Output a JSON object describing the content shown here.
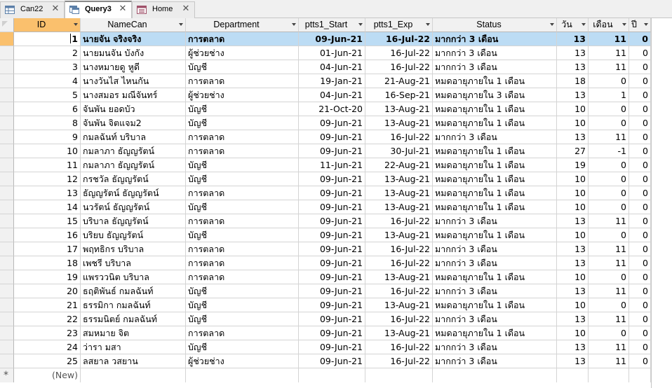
{
  "tabs": [
    {
      "label": "Can22",
      "active": false
    },
    {
      "label": "Query3",
      "active": true
    },
    {
      "label": "Home",
      "active": false
    }
  ],
  "columns": [
    "ID",
    "NameCan",
    "Department",
    "ptts1_Start",
    "ptts1_Exp",
    "Status",
    "วัน",
    "เดือน",
    "ปี"
  ],
  "rows": [
    [
      "1",
      "นายจัน จริงจริง",
      "การตลาด",
      "09-Jun-21",
      "16-Jul-22",
      "มากกว่า 3 เดือน",
      "13",
      "11",
      "0"
    ],
    [
      "2",
      "นายมนจัน บังกัง",
      "ผู้ช่วยช่าง",
      "01-Jun-21",
      "16-Jul-22",
      "มากกว่า 3 เดือน",
      "13",
      "11",
      "0"
    ],
    [
      "3",
      "นางหมายดู หูดี",
      "บัญชี",
      "04-Jun-21",
      "16-Jul-22",
      "มากกว่า 3 เดือน",
      "13",
      "11",
      "0"
    ],
    [
      "4",
      "นางวันไส ไหนกัน",
      "การตลาด",
      "19-Jan-21",
      "21-Aug-21",
      "หมดอายุภายใน 1 เดือน",
      "18",
      "0",
      "0"
    ],
    [
      "5",
      "นางสมอร มณีจันทร์",
      "ผู้ช่วยช่าง",
      "04-Jun-21",
      "16-Sep-21",
      "หมดอายุภายใน 3 เดือน",
      "13",
      "1",
      "0"
    ],
    [
      "6",
      "จันพัน ยอดบัว",
      "บัญชี",
      "21-Oct-20",
      "13-Aug-21",
      "หมดอายุภายใน 1 เดือน",
      "10",
      "0",
      "0"
    ],
    [
      "8",
      "จันพัน จิตแจม2",
      "บัญชี",
      "09-Jun-21",
      "13-Aug-21",
      "หมดอายุภายใน 1 เดือน",
      "10",
      "0",
      "0"
    ],
    [
      "9",
      "กมลฉันท์ บริบาล",
      "การตลาด",
      "09-Jun-21",
      "16-Jul-22",
      "มากกว่า 3 เดือน",
      "13",
      "11",
      "0"
    ],
    [
      "10",
      "กมลาภา ธัญญรัตน์",
      "การตลาด",
      "09-Jun-21",
      "30-Jul-21",
      "หมดอายุภายใน 1 เดือน",
      "27",
      "-1",
      "0"
    ],
    [
      "11",
      "กมลาภา ธัญญรัตน์",
      "บัญชี",
      "11-Jun-21",
      "22-Aug-21",
      "หมดอายุภายใน 1 เดือน",
      "19",
      "0",
      "0"
    ],
    [
      "12",
      "กรชวัล ธัญญรัตน์",
      "บัญชี",
      "09-Jun-21",
      "13-Aug-21",
      "หมดอายุภายใน 1 เดือน",
      "10",
      "0",
      "0"
    ],
    [
      "13",
      "ธัญญรัตน์ ธัญญรัตน์",
      "การตลาด",
      "09-Jun-21",
      "13-Aug-21",
      "หมดอายุภายใน 1 เดือน",
      "10",
      "0",
      "0"
    ],
    [
      "14",
      "นวรัตน์ ธัญญรัตน์",
      "บัญชี",
      "09-Jun-21",
      "13-Aug-21",
      "หมดอายุภายใน 1 เดือน",
      "10",
      "0",
      "0"
    ],
    [
      "15",
      "บริบาล ธัญญรัตน์",
      "การตลาด",
      "09-Jun-21",
      "16-Jul-22",
      "มากกว่า 3 เดือน",
      "13",
      "11",
      "0"
    ],
    [
      "16",
      "บริยบ ธัญญรัตน์",
      "บัญชี",
      "09-Jun-21",
      "13-Aug-21",
      "หมดอายุภายใน 1 เดือน",
      "10",
      "0",
      "0"
    ],
    [
      "17",
      "พฤทธิกร บริบาล",
      "การตลาด",
      "09-Jun-21",
      "16-Jul-22",
      "มากกว่า 3 เดือน",
      "13",
      "11",
      "0"
    ],
    [
      "18",
      "เพชรี บริบาล",
      "การตลาด",
      "09-Jun-21",
      "16-Jul-22",
      "มากกว่า 3 เดือน",
      "13",
      "11",
      "0"
    ],
    [
      "19",
      "แพรววนิต บริบาล",
      "การตลาด",
      "09-Jun-21",
      "13-Aug-21",
      "หมดอายุภายใน 1 เดือน",
      "10",
      "0",
      "0"
    ],
    [
      "20",
      "ธฤติพันธ์ กมลฉันท์",
      "บัญชี",
      "09-Jun-21",
      "16-Jul-22",
      "มากกว่า 3 เดือน",
      "13",
      "11",
      "0"
    ],
    [
      "21",
      "ธรรมิกา กมลฉันท์",
      "บัญชี",
      "09-Jun-21",
      "13-Aug-21",
      "หมดอายุภายใน 1 เดือน",
      "10",
      "0",
      "0"
    ],
    [
      "22",
      "ธรรมนิตย์ กมลฉันท์",
      "บัญชี",
      "09-Jun-21",
      "16-Jul-22",
      "มากกว่า 3 เดือน",
      "13",
      "11",
      "0"
    ],
    [
      "23",
      "สมหมาย จิต",
      "การตลาด",
      "09-Jun-21",
      "13-Aug-21",
      "หมดอายุภายใน 1 เดือน",
      "10",
      "0",
      "0"
    ],
    [
      "24",
      "ว่ารา มสา",
      "บัญชี",
      "09-Jun-21",
      "16-Jul-22",
      "มากกว่า 3 เดือน",
      "13",
      "11",
      "0"
    ],
    [
      "25",
      "ลสยาล วสยาน",
      "ผู้ช่วยช่าง",
      "09-Jun-21",
      "16-Jul-22",
      "มากกว่า 3 เดือน",
      "13",
      "11",
      "0"
    ]
  ],
  "new_row_label": "(New)",
  "colors": {
    "id_header": "#fac06d",
    "current_row": "#bcdcf4",
    "header_bg": "#f1f1f1",
    "grid_line": "#d4d4d4"
  }
}
